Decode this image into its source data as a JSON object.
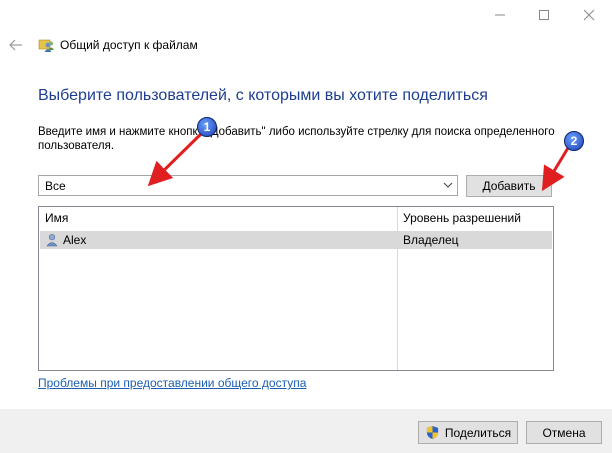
{
  "window": {
    "title": "Общий доступ к файлам"
  },
  "heading": "Выберите пользователей, с которыми вы хотите поделиться",
  "instruction_line1": "Введите имя и нажмите кнопку \"Добавить\" либо используйте стрелку для поиска определенного",
  "instruction_line2": "пользователя.",
  "combo": {
    "value": "Все"
  },
  "add_button": "Добавить",
  "table": {
    "headers": [
      "Имя",
      "Уровень разрешений"
    ],
    "rows": [
      {
        "name": "Alex",
        "permission": "Владелец"
      }
    ]
  },
  "help_link": "Проблемы при предоставлении общего доступа",
  "footer": {
    "share_label": "Поделиться",
    "cancel_label": "Отмена"
  },
  "annotations": [
    "1",
    "2"
  ],
  "colors": {
    "heading": "#1e3f8f",
    "link": "#1a5fb4",
    "arrow": "#e02020",
    "selection": "#d9d9d9"
  }
}
